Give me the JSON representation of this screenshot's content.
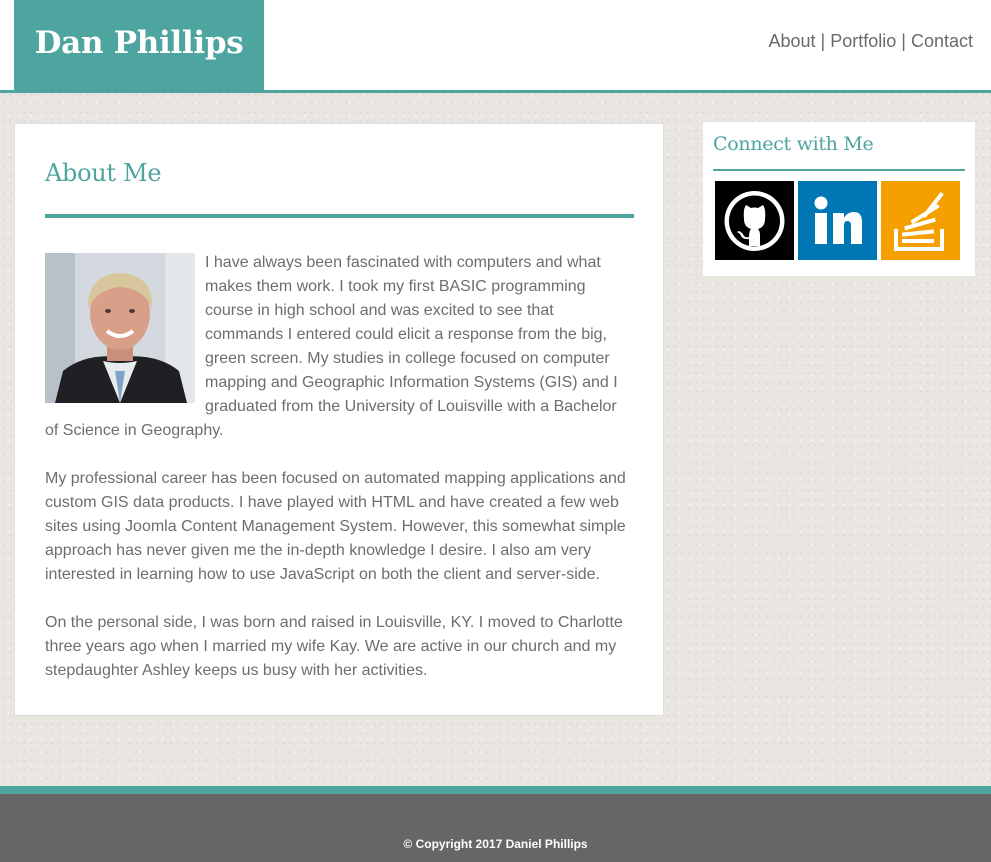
{
  "header": {
    "brand": "Dan Phillips",
    "nav": [
      {
        "label": "About"
      },
      {
        "label": "Portfolio"
      },
      {
        "label": "Contact"
      }
    ],
    "separator": "|"
  },
  "about": {
    "title": "About Me",
    "paragraphs": [
      "I have always been fascinated with computers and what makes them work. I took my first BASIC programming course in high school and was excited to see that commands I entered could elicit a response from the big, green screen. My studies in college focused on computer mapping and Geographic Information Systems (GIS) and I graduated from the University of Louisville with a Bachelor of Science in Geography.",
      "My professional career has been focused on automated mapping applications and custom GIS data products. I have played with HTML and have created a few web sites using Joomla Content Management System. However, this somewhat simple approach has never given me the in-depth knowledge I desire. I also am very interested in learning how to use JavaScript on both the client and server-side.",
      "On the personal side, I was born and raised in Louisville, KY. I moved to Charlotte three years ago when I married my wife Kay. We are active in our church and my stepdaughter Ashley keeps us busy with her activities."
    ]
  },
  "connect": {
    "title": "Connect with Me",
    "icons": [
      {
        "name": "github-icon",
        "color": "#000000"
      },
      {
        "name": "linkedin-icon",
        "color": "#0077b5"
      },
      {
        "name": "stackoverflow-icon",
        "color": "#f5a000"
      }
    ]
  },
  "footer": {
    "copyright": "© Copyright 2017 Daniel Phillips"
  },
  "colors": {
    "accent": "#4ea49e",
    "footer_bg": "#666666",
    "text": "#6d6d6d"
  }
}
